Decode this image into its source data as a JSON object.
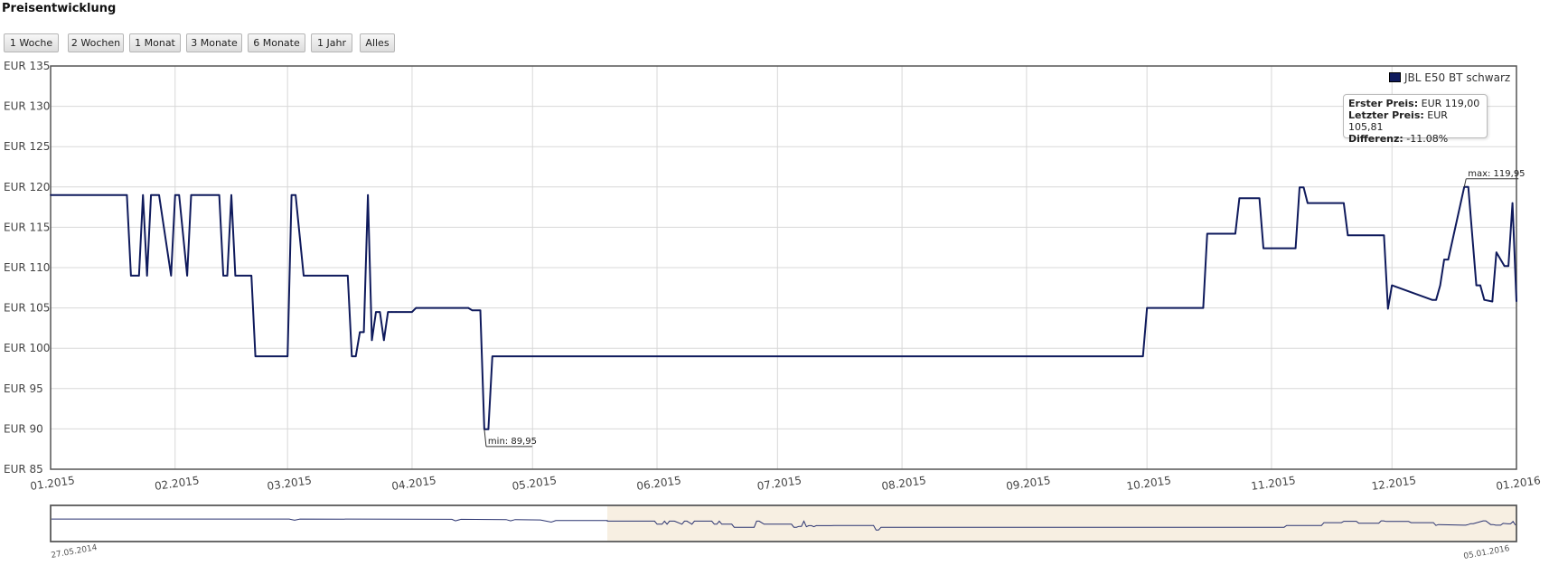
{
  "page": {
    "title": "Preisentwicklung"
  },
  "range_buttons": [
    "1 Woche",
    "2 Wochen",
    "1 Monat",
    "3 Monate",
    "6 Monate",
    "1 Jahr",
    "Alles"
  ],
  "summary": {
    "first_label": "Erster Preis:",
    "first_value": "EUR 119,00",
    "last_label": "Letzter Preis:",
    "last_value": "EUR 105,81",
    "diff_label": "Differenz:",
    "diff_value": "-11.08%"
  },
  "colors": {
    "series": "#0f1a5c",
    "grid": "#d8d8d8",
    "navigator_selection": "#f7efe2"
  },
  "chart_data": {
    "type": "line",
    "title": "",
    "xlabel": "",
    "ylabel": "",
    "ylim": [
      85,
      135
    ],
    "xlim": [
      "2015-01-01",
      "2016-01-01"
    ],
    "y_ticks": [
      "EUR 85",
      "EUR 90",
      "EUR 95",
      "EUR 100",
      "EUR 105",
      "EUR 110",
      "EUR 115",
      "EUR 120",
      "EUR 125",
      "EUR 130",
      "EUR 135"
    ],
    "x_ticks": [
      "01.2015",
      "02.2015",
      "03.2015",
      "04.2015",
      "05.2015",
      "06.2015",
      "07.2015",
      "08.2015",
      "09.2015",
      "10.2015",
      "11.2015",
      "12.2015",
      "01.2016"
    ],
    "grid": true,
    "legend": "top-right",
    "series": [
      {
        "name": "JBL E50 BT schwarz",
        "x": [
          "2015-01-01",
          "2015-01-20",
          "2015-01-21",
          "2015-01-23",
          "2015-01-24",
          "2015-01-25",
          "2015-01-26",
          "2015-01-27",
          "2015-01-28",
          "2015-01-31",
          "2015-02-01",
          "2015-02-02",
          "2015-02-04",
          "2015-02-05",
          "2015-02-06",
          "2015-02-07",
          "2015-02-12",
          "2015-02-13",
          "2015-02-14",
          "2015-02-15",
          "2015-02-16",
          "2015-02-20",
          "2015-02-21",
          "2015-03-01",
          "2015-03-02",
          "2015-03-03",
          "2015-03-05",
          "2015-03-06",
          "2015-03-16",
          "2015-03-17",
          "2015-03-18",
          "2015-03-19",
          "2015-03-20",
          "2015-03-21",
          "2015-03-22",
          "2015-03-23",
          "2015-03-24",
          "2015-03-25",
          "2015-03-26",
          "2015-03-27",
          "2015-03-28",
          "2015-04-01",
          "2015-04-02",
          "2015-04-15",
          "2015-04-16",
          "2015-04-18",
          "2015-04-19",
          "2015-04-20",
          "2015-04-21",
          "2015-04-22",
          "2015-09-30",
          "2015-10-01",
          "2015-10-15",
          "2015-10-16",
          "2015-10-23",
          "2015-10-24",
          "2015-10-29",
          "2015-10-30",
          "2015-11-07",
          "2015-11-08",
          "2015-11-09",
          "2015-11-10",
          "2015-11-19",
          "2015-11-20",
          "2015-11-28",
          "2015-11-29",
          "2015-11-30",
          "2015-12-01",
          "2015-12-11",
          "2015-12-12",
          "2015-12-13",
          "2015-12-14",
          "2015-12-15",
          "2015-12-19",
          "2015-12-20",
          "2015-12-22",
          "2015-12-23",
          "2015-12-24",
          "2015-12-26",
          "2015-12-27",
          "2015-12-29",
          "2015-12-30",
          "2015-12-31",
          "2016-01-01"
        ],
        "values": [
          119,
          119,
          109,
          109,
          119,
          109,
          119,
          119,
          119,
          109,
          119,
          119,
          109,
          119,
          119,
          119,
          119,
          109,
          109,
          119,
          109,
          109,
          99,
          99,
          119,
          119,
          109,
          109,
          109,
          99,
          99,
          102,
          102,
          119,
          101,
          104.5,
          104.5,
          101,
          104.5,
          104.5,
          104.5,
          104.5,
          105,
          105,
          104.7,
          104.7,
          89.95,
          89.95,
          99,
          99,
          99,
          105,
          105,
          114.2,
          114.2,
          118.6,
          118.6,
          112.4,
          112.4,
          119.95,
          119.95,
          118,
          118,
          114,
          114,
          114,
          104.9,
          107.8,
          106,
          106,
          107.8,
          111,
          111,
          120,
          120,
          107.8,
          107.8,
          106,
          105.8,
          111.9,
          110.2,
          110.2,
          118,
          105.81
        ]
      }
    ],
    "annotations": [
      "min: 89,95",
      "max: 119,95"
    ],
    "navigator": {
      "start_label": "27.05.2014",
      "end_label": "05.01.2016"
    }
  }
}
